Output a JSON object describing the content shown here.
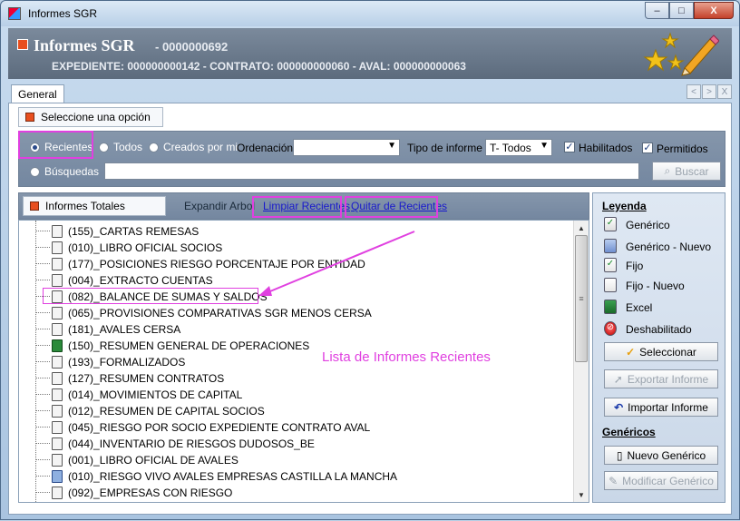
{
  "window": {
    "title": "Informes SGR",
    "controls": {
      "minimize": "–",
      "maximize": "□",
      "close": "X"
    }
  },
  "header": {
    "title": "Informes SGR",
    "code": "- 0000000692",
    "subtitle": "EXPEDIENTE: 000000000142 - CONTRATO: 000000000060 - AVAL: 000000000063"
  },
  "tabs": [
    {
      "label": "General",
      "active": true
    }
  ],
  "tab_nav": {
    "prev": "<",
    "next": ">",
    "close": "X"
  },
  "options": {
    "section_label": "Seleccione una opción",
    "radios": [
      {
        "label": "Recientes",
        "selected": true
      },
      {
        "label": "Todos",
        "selected": false
      },
      {
        "label": "Creados por mi",
        "selected": false
      },
      {
        "label": "Búsquedas",
        "selected": false
      }
    ],
    "ordenacion_label": "Ordenación",
    "ordenacion_value": "",
    "tipo_label": "Tipo de informe",
    "tipo_value": "T- Todos",
    "habilitados_label": "Habilitados",
    "habilitados_checked": true,
    "permitidos_label": "Permitidos",
    "permitidos_checked": true,
    "search_value": "",
    "search_button": "Buscar"
  },
  "list": {
    "section_label": "Informes Totales",
    "expand_label": "Expandir Arbol",
    "clear_link": "Limpiar Recientes",
    "remove_link": "Quitar de Recientes",
    "items": [
      {
        "label": "(155)_CARTAS REMESAS",
        "icon": "fixed-doc-icon"
      },
      {
        "label": "(010)_LIBRO OFICIAL SOCIOS",
        "icon": "fixed-doc-icon"
      },
      {
        "label": "(177)_POSICIONES RIESGO PORCENTAJE POR ENTIDAD",
        "icon": "fixed-doc-icon"
      },
      {
        "label": "(004)_EXTRACTO CUENTAS",
        "icon": "fixed-doc-icon"
      },
      {
        "label": "(082)_BALANCE DE SUMAS Y SALDOS",
        "icon": "fixed-doc-icon"
      },
      {
        "label": "(065)_PROVISIONES COMPARATIVAS SGR MENOS CERSA",
        "icon": "fixed-doc-icon"
      },
      {
        "label": "(181)_AVALES CERSA",
        "icon": "fixed-doc-icon"
      },
      {
        "label": "(150)_RESUMEN GENERAL DE OPERACIONES",
        "icon": "excel-icon"
      },
      {
        "label": "(193)_FORMALIZADOS",
        "icon": "fixed-doc-icon"
      },
      {
        "label": "(127)_RESUMEN CONTRATOS",
        "icon": "fixed-doc-icon"
      },
      {
        "label": "(014)_MOVIMIENTOS DE CAPITAL",
        "icon": "fixed-doc-icon"
      },
      {
        "label": "(012)_RESUMEN DE CAPITAL SOCIOS",
        "icon": "fixed-doc-icon"
      },
      {
        "label": "(045)_RIESGO POR SOCIO EXPEDIENTE CONTRATO AVAL",
        "icon": "fixed-doc-icon"
      },
      {
        "label": "(044)_INVENTARIO DE RIESGOS DUDOSOS_BE",
        "icon": "fixed-doc-icon"
      },
      {
        "label": "(001)_LIBRO OFICIAL DE AVALES",
        "icon": "fixed-doc-icon"
      },
      {
        "label": "(010)_RIESGO VIVO AVALES EMPRESAS CASTILLA LA MANCHA",
        "icon": "generic-new-icon"
      },
      {
        "label": "(092)_EMPRESAS CON RIESGO",
        "icon": "fixed-doc-icon"
      }
    ]
  },
  "legend": {
    "title": "Leyenda",
    "items": [
      {
        "label": "Genérico",
        "icon": "generic-icon"
      },
      {
        "label": "Genérico - Nuevo",
        "icon": "generic-new-icon"
      },
      {
        "label": "Fijo",
        "icon": "fixed-icon"
      },
      {
        "label": "Fijo - Nuevo",
        "icon": "fixed-new-icon"
      },
      {
        "label": "Excel",
        "icon": "excel-icon"
      },
      {
        "label": "Deshabilitado",
        "icon": "disabled-icon"
      }
    ],
    "select_button": "Seleccionar",
    "export_button": "Exportar Informe",
    "import_button": "Importar Informe",
    "genericos_title": "Genéricos",
    "new_generic_button": "Nuevo Genérico",
    "edit_generic_button": "Modificar Genérico"
  },
  "annotation": {
    "text": "Lista de Informes Recientes",
    "color": "#e040e0"
  }
}
